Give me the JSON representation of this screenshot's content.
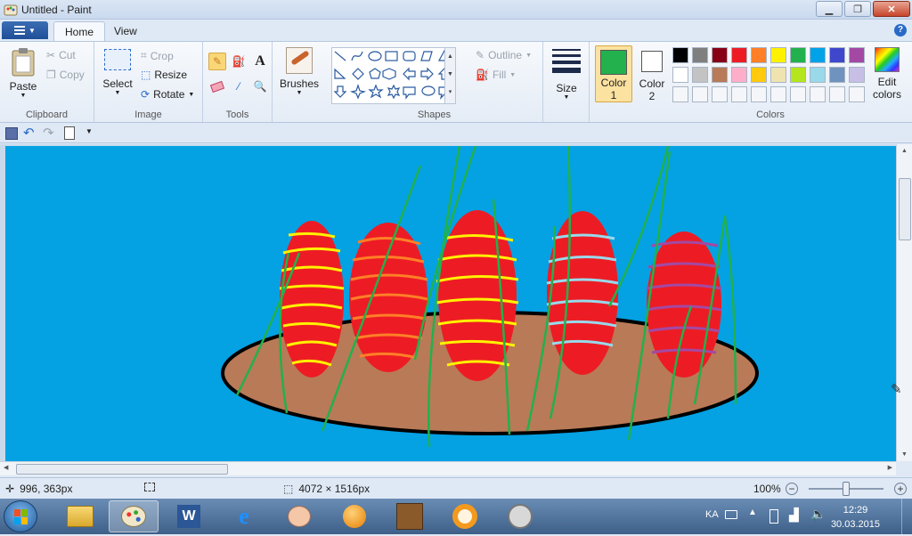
{
  "window": {
    "title": "Untitled - Paint"
  },
  "tabs": [
    {
      "label": "Home"
    },
    {
      "label": "View"
    }
  ],
  "clipboard": {
    "group_label": "Clipboard",
    "paste_label": "Paste",
    "cut_label": "Cut",
    "copy_label": "Copy"
  },
  "image": {
    "group_label": "Image",
    "select_label": "Select",
    "crop_label": "Crop",
    "resize_label": "Resize",
    "rotate_label": "Rotate"
  },
  "tools": {
    "group_label": "Tools",
    "text_tool": "A"
  },
  "brushes": {
    "label": "Brushes"
  },
  "shapes": {
    "group_label": "Shapes",
    "outline_label": "Outline",
    "fill_label": "Fill"
  },
  "size": {
    "label": "Size"
  },
  "color_select": {
    "color1_label": "Color",
    "color1_num": "1",
    "color2_label": "Color",
    "color2_num": "2",
    "color1_value": "#22b14c",
    "color2_value": "#ffffff"
  },
  "colors": {
    "group_label": "Colors",
    "edit_label": "Edit",
    "edit_label2": "colors",
    "row1": [
      "#000000",
      "#7f7f7f",
      "#880015",
      "#ed1c24",
      "#ff7f27",
      "#fff200",
      "#22b14c",
      "#00a2e8",
      "#3f48cc",
      "#a349a4"
    ],
    "row2": [
      "#ffffff",
      "#c3c3c3",
      "#b97a57",
      "#ffaec9",
      "#ffc90e",
      "#efe4b0",
      "#b5e61d",
      "#99d9ea",
      "#7092be",
      "#c8bfe7"
    ]
  },
  "status": {
    "cursor_pos": "996, 363px",
    "image_size": "4072 × 1516px",
    "zoom": "100%"
  },
  "taskbar": {
    "language": "KA",
    "time": "12:29",
    "date": "30.03.2015"
  }
}
